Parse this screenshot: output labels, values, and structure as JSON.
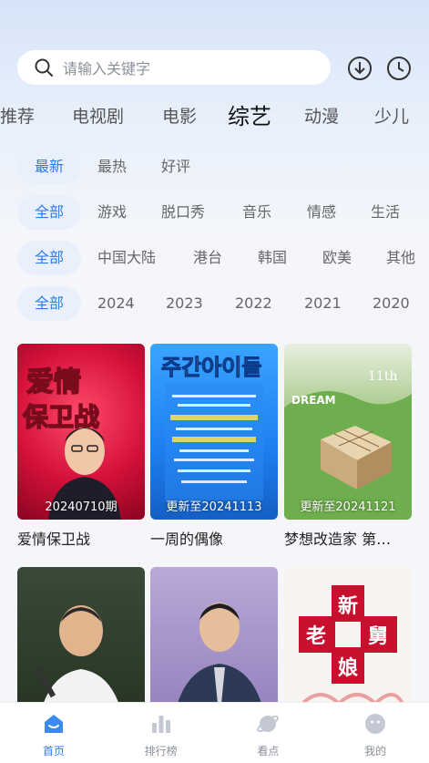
{
  "search": {
    "placeholder": "请输入关键字"
  },
  "category_tabs": [
    {
      "label": "推荐"
    },
    {
      "label": "电视剧"
    },
    {
      "label": "电影"
    },
    {
      "label": "综艺"
    },
    {
      "label": "动漫"
    },
    {
      "label": "少儿"
    }
  ],
  "active_tab_index": 3,
  "filters": {
    "sort": [
      "最新",
      "最热",
      "好评"
    ],
    "genre": [
      "全部",
      "游戏",
      "脱口秀",
      "音乐",
      "情感",
      "生活"
    ],
    "region": [
      "全部",
      "中国大陆",
      "港台",
      "韩国",
      "欧美",
      "其他"
    ],
    "year": [
      "全部",
      "2024",
      "2023",
      "2022",
      "2021",
      "2020"
    ]
  },
  "cards": [
    {
      "title": "爱情保卫战",
      "tag": "20240710期",
      "poster_text": "爱情保卫战"
    },
    {
      "title": "一周的偶像",
      "tag": "更新至20241113",
      "poster_text": "주간아이돌"
    },
    {
      "title": "梦想改造家 第…",
      "tag": "更新至20241121",
      "poster_text": "DREAM"
    },
    {
      "title": "",
      "tag": "",
      "poster_text": ""
    },
    {
      "title": "",
      "tag": "",
      "poster_text": ""
    },
    {
      "title": "",
      "tag": "",
      "poster_text": "新老娘舅"
    }
  ],
  "bottom_nav": [
    {
      "label": "首页",
      "icon": "home-icon"
    },
    {
      "label": "排行榜",
      "icon": "ranking-icon"
    },
    {
      "label": "看点",
      "icon": "planet-icon"
    },
    {
      "label": "我的",
      "icon": "profile-icon"
    }
  ],
  "colors": {
    "accent": "#2f7be8",
    "chip_active_bg": "#eaf0fb"
  }
}
